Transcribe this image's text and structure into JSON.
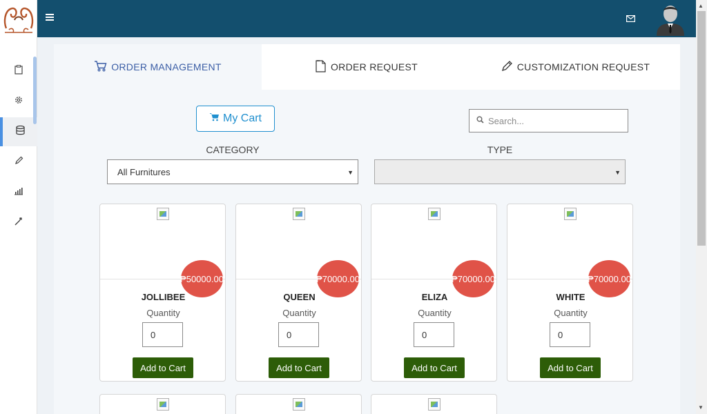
{
  "topbar": {
    "menu_icon": "hamburger-icon",
    "mail_icon": "envelope-icon",
    "avatar": "user-avatar",
    "bg_color": "#134f6e"
  },
  "sidebar": {
    "logo": "brand-logo",
    "items": [
      {
        "icon": "clipboard-icon",
        "active": false
      },
      {
        "icon": "gear-icon",
        "active": false
      },
      {
        "icon": "database-icon",
        "active": true
      },
      {
        "icon": "pencil-icon",
        "active": false
      },
      {
        "icon": "bar-chart-icon",
        "active": false
      },
      {
        "icon": "magic-wand-icon",
        "active": false
      }
    ]
  },
  "tabs": [
    {
      "label": "ORDER MANAGEMENT",
      "icon": "cart-icon",
      "active": true
    },
    {
      "label": "ORDER REQUEST",
      "icon": "document-icon",
      "active": false
    },
    {
      "label": "CUSTOMIZATION REQUEST",
      "icon": "pencil-icon",
      "active": false
    }
  ],
  "toolbar": {
    "cart_label": "My Cart",
    "search_placeholder": "Search..."
  },
  "filters": {
    "category_label": "CATEGORY",
    "category_value": "All Furnitures",
    "type_label": "TYPE",
    "type_value": ""
  },
  "products": [
    {
      "name": "JOLLIBEE",
      "price": "₱50000.00",
      "qty_label": "Quantity",
      "qty": "0",
      "button": "Add to Cart"
    },
    {
      "name": "QUEEN",
      "price": "₱70000.00",
      "qty_label": "Quantity",
      "qty": "0",
      "button": "Add to Cart"
    },
    {
      "name": "ELIZA",
      "price": "₱70000.00",
      "qty_label": "Quantity",
      "qty": "0",
      "button": "Add to Cart"
    },
    {
      "name": "WHITE",
      "price": "₱70000.00",
      "qty_label": "Quantity",
      "qty": "0",
      "button": "Add to Cart"
    }
  ],
  "colors": {
    "accent": "#1f8fcf",
    "price_badge": "#e05348",
    "add_button": "#2d5d08",
    "active_tab_text": "#3a5da5"
  }
}
